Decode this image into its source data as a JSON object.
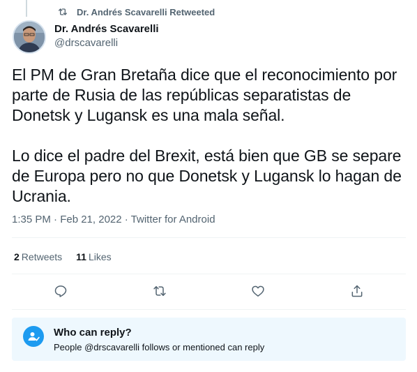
{
  "retweet_banner": {
    "text": "Dr. Andrés Scavarelli Retweeted",
    "icon": "retweet-icon"
  },
  "author": {
    "name": "Dr. Andrés Scavarelli",
    "handle": "@drscavarelli"
  },
  "tweet": {
    "paragraphs": [
      "El PM de Gran Bretaña dice que el reconocimiento por parte de Rusia de las repúblicas separatistas de Donetsk y Lugansk es una mala señal.",
      "Lo dice el padre del Brexit, está bien que GB se separe de Europa pero no que Donetsk y Lugansk lo hagan de Ucrania."
    ],
    "meta": "1:35 PM · Feb 21, 2022 · Twitter for Android"
  },
  "stats": {
    "retweets_count": "2",
    "retweets_label": "Retweets",
    "likes_count": "11",
    "likes_label": "Likes"
  },
  "actions": [
    "reply-icon",
    "retweet-icon",
    "like-icon",
    "share-icon"
  ],
  "reply_settings": {
    "title": "Who can reply?",
    "description": "People @drscavarelli follows or mentioned can reply"
  },
  "colors": {
    "accent": "#1d9bf0",
    "muted": "#536471",
    "reply_box_bg": "#eef8fe"
  }
}
